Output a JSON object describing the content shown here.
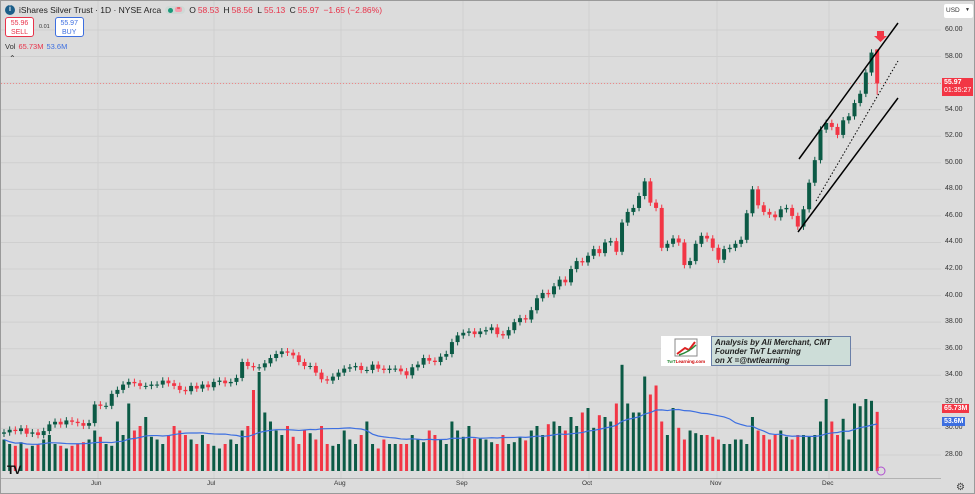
{
  "header": {
    "title": "iShares Silver Trust · 1D · NYSE Arca",
    "o_label": "O",
    "o": "58.53",
    "h_label": "H",
    "h": "58.56",
    "l_label": "L",
    "l": "55.13",
    "c_label": "C",
    "c": "55.97",
    "change": "−1.65 (−2.86%)"
  },
  "trade": {
    "sell_price": "55.96",
    "sell_label": "SELL",
    "spread": "0.01",
    "buy_price": "55.97",
    "buy_label": "BUY"
  },
  "volume": {
    "label": "Vol",
    "value": "65.73M",
    "ma": "53.6M"
  },
  "currency": "USD",
  "axis": {
    "ticks": [
      "60.00",
      "58.00",
      "56.00",
      "54.00",
      "52.00",
      "50.00",
      "48.00",
      "46.00",
      "44.00",
      "42.00",
      "40.00",
      "38.00",
      "36.00",
      "34.00",
      "32.00",
      "30.00",
      "28.00"
    ],
    "last_price": "55.97",
    "countdown": "01:35:27",
    "vol_tag": "65.73M",
    "vol_ma_tag": "53.6M"
  },
  "months": [
    "Jun",
    "Jul",
    "Aug",
    "Sep",
    "Oct",
    "Nov",
    "Dec"
  ],
  "annotation": {
    "logo_text": "TwTLearning.com",
    "line1": "Analysis by Ali Merchant, CMT",
    "line2": "Founder TwT Learning",
    "line3": "on X =@twtlearning"
  },
  "colors": {
    "up": "#0b5a45",
    "down": "#f23645",
    "vol_ma": "#3d6fe0"
  },
  "chart_data": {
    "type": "candlestick",
    "price_range": [
      28,
      60
    ],
    "closes": [
      29.7,
      29.9,
      29.8,
      30.0,
      29.6,
      29.7,
      29.5,
      29.8,
      30.3,
      30.5,
      30.3,
      30.6,
      30.5,
      30.4,
      30.2,
      30.4,
      31.8,
      31.7,
      31.7,
      32.6,
      32.9,
      33.3,
      33.5,
      33.4,
      33.2,
      33.2,
      33.3,
      33.3,
      33.6,
      33.4,
      33.2,
      32.9,
      32.8,
      33.2,
      33.0,
      33.3,
      33.1,
      33.5,
      33.6,
      33.4,
      33.5,
      33.8,
      35.0,
      34.7,
      34.6,
      34.6,
      34.9,
      35.3,
      35.6,
      35.8,
      35.7,
      35.5,
      35.0,
      34.7,
      34.7,
      34.2,
      33.7,
      33.6,
      33.9,
      34.2,
      34.5,
      34.6,
      34.7,
      34.4,
      34.4,
      34.8,
      34.5,
      34.4,
      34.5,
      34.5,
      34.3,
      34.0,
      34.6,
      34.8,
      35.3,
      35.1,
      35.0,
      35.4,
      35.6,
      36.5,
      37.0,
      37.2,
      37.3,
      37.1,
      37.3,
      37.4,
      37.6,
      37.1,
      37.0,
      37.4,
      38.0,
      38.3,
      38.2,
      38.9,
      39.8,
      40.2,
      40.1,
      40.7,
      41.2,
      41.0,
      42.0,
      42.6,
      42.5,
      43.0,
      43.5,
      43.2,
      44.0,
      44.1,
      43.3,
      45.5,
      46.3,
      46.6,
      47.5,
      48.6,
      47.0,
      46.6,
      43.6,
      43.9,
      44.3,
      44.0,
      42.3,
      42.6,
      43.9,
      44.5,
      44.3,
      43.6,
      42.7,
      43.5,
      43.6,
      43.9,
      44.2,
      46.2,
      48.0,
      46.8,
      46.3,
      46.1,
      45.9,
      46.5,
      46.6,
      46.0,
      45.2,
      46.5,
      48.5,
      50.2,
      52.5,
      53.0,
      52.7,
      52.1,
      53.2,
      53.5,
      54.5,
      55.2,
      56.8,
      58.3,
      55.97
    ],
    "last_candle": {
      "open": 58.53,
      "high": 58.56,
      "low": 55.13,
      "close": 55.97
    },
    "volumes_m": [
      35,
      30,
      28,
      32,
      25,
      28,
      30,
      35,
      40,
      30,
      28,
      25,
      28,
      30,
      32,
      35,
      45,
      38,
      30,
      28,
      55,
      40,
      75,
      45,
      50,
      60,
      38,
      35,
      30,
      40,
      50,
      45,
      40,
      35,
      30,
      40,
      30,
      28,
      25,
      30,
      35,
      30,
      45,
      50,
      90,
      110,
      65,
      55,
      45,
      40,
      50,
      38,
      30,
      45,
      42,
      35,
      50,
      30,
      28,
      30,
      45,
      35,
      30,
      40,
      55,
      30,
      25,
      35,
      30,
      30,
      30,
      30,
      40,
      35,
      32,
      45,
      40,
      35,
      30,
      55,
      45,
      38,
      50,
      36,
      36,
      35,
      32,
      30,
      40,
      30,
      32,
      38,
      34,
      45,
      50,
      40,
      52,
      55,
      50,
      45,
      60,
      50,
      65,
      70,
      48,
      62,
      60,
      55,
      75,
      118,
      75,
      65,
      65,
      105,
      85,
      95,
      55,
      40,
      70,
      48,
      35,
      45,
      42,
      40,
      40,
      38,
      35,
      30,
      30,
      35,
      35,
      30,
      60,
      45,
      40,
      35,
      40,
      45,
      38,
      35,
      40,
      40,
      38,
      40,
      55,
      80,
      55,
      40,
      58,
      35,
      75,
      72,
      80,
      78,
      65.73
    ]
  }
}
